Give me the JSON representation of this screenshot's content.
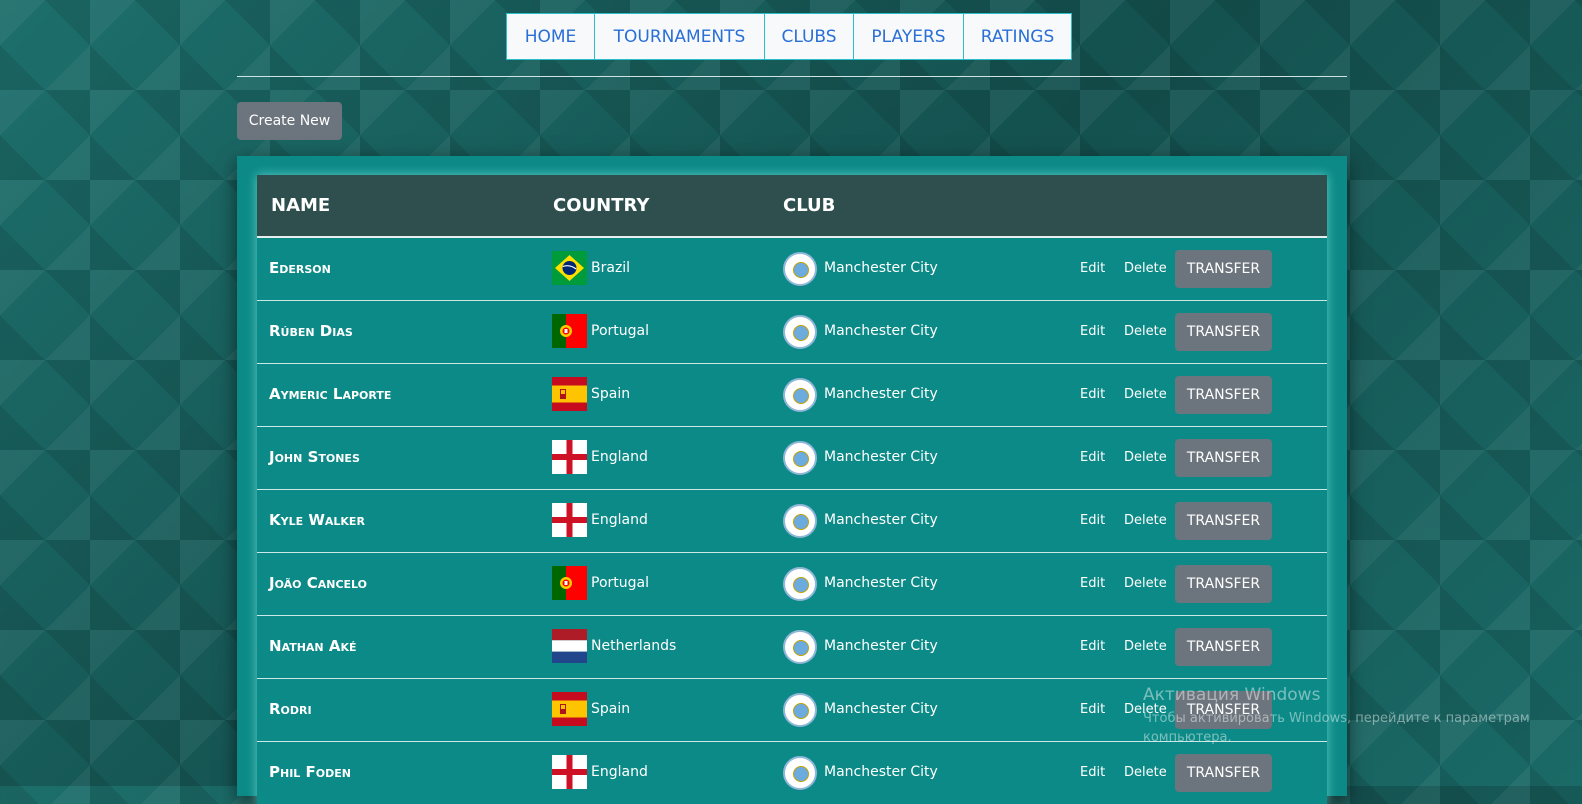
{
  "nav": [
    "HOME",
    "TOURNAMENTS",
    "CLUBS",
    "PLAYERS",
    "RATINGS"
  ],
  "toolbar": {
    "create_label": "Create New"
  },
  "table": {
    "headers": {
      "name": "NAME",
      "country": "COUNTRY",
      "club": "CLUB"
    },
    "rows": [
      {
        "name": "Ederson",
        "country": "Brazil",
        "flag": "brazil",
        "club": "Manchester City",
        "edit": "Edit",
        "delete": "Delete",
        "transfer": "TRANSFER"
      },
      {
        "name": "Rúben Dias",
        "country": "Portugal",
        "flag": "portugal",
        "club": "Manchester City",
        "edit": "Edit",
        "delete": "Delete",
        "transfer": "TRANSFER"
      },
      {
        "name": "Aymeric Laporte",
        "country": "Spain",
        "flag": "spain",
        "club": "Manchester City",
        "edit": "Edit",
        "delete": "Delete",
        "transfer": "TRANSFER"
      },
      {
        "name": "John Stones",
        "country": "England",
        "flag": "england",
        "club": "Manchester City",
        "edit": "Edit",
        "delete": "Delete",
        "transfer": "TRANSFER"
      },
      {
        "name": "Kyle Walker",
        "country": "England",
        "flag": "england",
        "club": "Manchester City",
        "edit": "Edit",
        "delete": "Delete",
        "transfer": "TRANSFER"
      },
      {
        "name": "João Cancelo",
        "country": "Portugal",
        "flag": "portugal",
        "club": "Manchester City",
        "edit": "Edit",
        "delete": "Delete",
        "transfer": "TRANSFER"
      },
      {
        "name": "Nathan Aké",
        "country": "Netherlands",
        "flag": "netherlands",
        "club": "Manchester City",
        "edit": "Edit",
        "delete": "Delete",
        "transfer": "TRANSFER"
      },
      {
        "name": "Rodri",
        "country": "Spain",
        "flag": "spain",
        "club": "Manchester City",
        "edit": "Edit",
        "delete": "Delete",
        "transfer": "TRANSFER"
      },
      {
        "name": "Phil Foden",
        "country": "England",
        "flag": "england",
        "club": "Manchester City",
        "edit": "Edit",
        "delete": "Delete",
        "transfer": "TRANSFER"
      }
    ]
  },
  "watermark": {
    "line1": "Активация Windows",
    "line2": "Чтобы активировать Windows, перейдите к параметрам компьютера."
  }
}
